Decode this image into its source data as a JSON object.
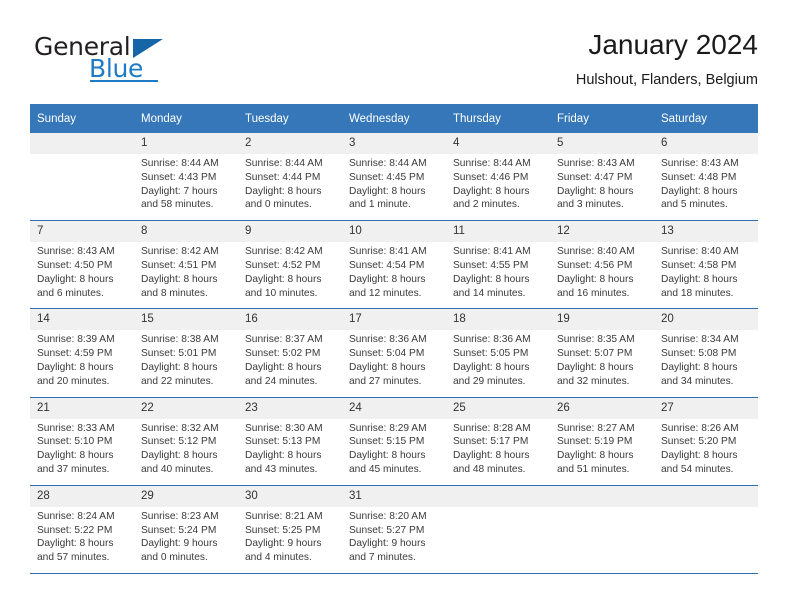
{
  "brand": {
    "name_top": "General",
    "name_bottom": "Blue",
    "accent_color": "#1f7cc4",
    "triangle_color": "#1565a8"
  },
  "header": {
    "title": "January 2024",
    "subtitle": "Hulshout, Flanders, Belgium"
  },
  "theme": {
    "header_row_bg": "#3577b9",
    "header_row_text": "#ffffff",
    "daynum_bg": "#f0f0f0",
    "rule_color": "#2f6fae"
  },
  "columns": [
    "Sunday",
    "Monday",
    "Tuesday",
    "Wednesday",
    "Thursday",
    "Friday",
    "Saturday"
  ],
  "weeks": [
    [
      {
        "day": "",
        "empty": true,
        "sunrise": "",
        "sunset": "",
        "daylight1": "",
        "daylight2": ""
      },
      {
        "day": "1",
        "sunrise": "Sunrise: 8:44 AM",
        "sunset": "Sunset: 4:43 PM",
        "daylight1": "Daylight: 7 hours",
        "daylight2": "and 58 minutes."
      },
      {
        "day": "2",
        "sunrise": "Sunrise: 8:44 AM",
        "sunset": "Sunset: 4:44 PM",
        "daylight1": "Daylight: 8 hours",
        "daylight2": "and 0 minutes."
      },
      {
        "day": "3",
        "sunrise": "Sunrise: 8:44 AM",
        "sunset": "Sunset: 4:45 PM",
        "daylight1": "Daylight: 8 hours",
        "daylight2": "and 1 minute."
      },
      {
        "day": "4",
        "sunrise": "Sunrise: 8:44 AM",
        "sunset": "Sunset: 4:46 PM",
        "daylight1": "Daylight: 8 hours",
        "daylight2": "and 2 minutes."
      },
      {
        "day": "5",
        "sunrise": "Sunrise: 8:43 AM",
        "sunset": "Sunset: 4:47 PM",
        "daylight1": "Daylight: 8 hours",
        "daylight2": "and 3 minutes."
      },
      {
        "day": "6",
        "sunrise": "Sunrise: 8:43 AM",
        "sunset": "Sunset: 4:48 PM",
        "daylight1": "Daylight: 8 hours",
        "daylight2": "and 5 minutes."
      }
    ],
    [
      {
        "day": "7",
        "sunrise": "Sunrise: 8:43 AM",
        "sunset": "Sunset: 4:50 PM",
        "daylight1": "Daylight: 8 hours",
        "daylight2": "and 6 minutes."
      },
      {
        "day": "8",
        "sunrise": "Sunrise: 8:42 AM",
        "sunset": "Sunset: 4:51 PM",
        "daylight1": "Daylight: 8 hours",
        "daylight2": "and 8 minutes."
      },
      {
        "day": "9",
        "sunrise": "Sunrise: 8:42 AM",
        "sunset": "Sunset: 4:52 PM",
        "daylight1": "Daylight: 8 hours",
        "daylight2": "and 10 minutes."
      },
      {
        "day": "10",
        "sunrise": "Sunrise: 8:41 AM",
        "sunset": "Sunset: 4:54 PM",
        "daylight1": "Daylight: 8 hours",
        "daylight2": "and 12 minutes."
      },
      {
        "day": "11",
        "sunrise": "Sunrise: 8:41 AM",
        "sunset": "Sunset: 4:55 PM",
        "daylight1": "Daylight: 8 hours",
        "daylight2": "and 14 minutes."
      },
      {
        "day": "12",
        "sunrise": "Sunrise: 8:40 AM",
        "sunset": "Sunset: 4:56 PM",
        "daylight1": "Daylight: 8 hours",
        "daylight2": "and 16 minutes."
      },
      {
        "day": "13",
        "sunrise": "Sunrise: 8:40 AM",
        "sunset": "Sunset: 4:58 PM",
        "daylight1": "Daylight: 8 hours",
        "daylight2": "and 18 minutes."
      }
    ],
    [
      {
        "day": "14",
        "sunrise": "Sunrise: 8:39 AM",
        "sunset": "Sunset: 4:59 PM",
        "daylight1": "Daylight: 8 hours",
        "daylight2": "and 20 minutes."
      },
      {
        "day": "15",
        "sunrise": "Sunrise: 8:38 AM",
        "sunset": "Sunset: 5:01 PM",
        "daylight1": "Daylight: 8 hours",
        "daylight2": "and 22 minutes."
      },
      {
        "day": "16",
        "sunrise": "Sunrise: 8:37 AM",
        "sunset": "Sunset: 5:02 PM",
        "daylight1": "Daylight: 8 hours",
        "daylight2": "and 24 minutes."
      },
      {
        "day": "17",
        "sunrise": "Sunrise: 8:36 AM",
        "sunset": "Sunset: 5:04 PM",
        "daylight1": "Daylight: 8 hours",
        "daylight2": "and 27 minutes."
      },
      {
        "day": "18",
        "sunrise": "Sunrise: 8:36 AM",
        "sunset": "Sunset: 5:05 PM",
        "daylight1": "Daylight: 8 hours",
        "daylight2": "and 29 minutes."
      },
      {
        "day": "19",
        "sunrise": "Sunrise: 8:35 AM",
        "sunset": "Sunset: 5:07 PM",
        "daylight1": "Daylight: 8 hours",
        "daylight2": "and 32 minutes."
      },
      {
        "day": "20",
        "sunrise": "Sunrise: 8:34 AM",
        "sunset": "Sunset: 5:08 PM",
        "daylight1": "Daylight: 8 hours",
        "daylight2": "and 34 minutes."
      }
    ],
    [
      {
        "day": "21",
        "sunrise": "Sunrise: 8:33 AM",
        "sunset": "Sunset: 5:10 PM",
        "daylight1": "Daylight: 8 hours",
        "daylight2": "and 37 minutes."
      },
      {
        "day": "22",
        "sunrise": "Sunrise: 8:32 AM",
        "sunset": "Sunset: 5:12 PM",
        "daylight1": "Daylight: 8 hours",
        "daylight2": "and 40 minutes."
      },
      {
        "day": "23",
        "sunrise": "Sunrise: 8:30 AM",
        "sunset": "Sunset: 5:13 PM",
        "daylight1": "Daylight: 8 hours",
        "daylight2": "and 43 minutes."
      },
      {
        "day": "24",
        "sunrise": "Sunrise: 8:29 AM",
        "sunset": "Sunset: 5:15 PM",
        "daylight1": "Daylight: 8 hours",
        "daylight2": "and 45 minutes."
      },
      {
        "day": "25",
        "sunrise": "Sunrise: 8:28 AM",
        "sunset": "Sunset: 5:17 PM",
        "daylight1": "Daylight: 8 hours",
        "daylight2": "and 48 minutes."
      },
      {
        "day": "26",
        "sunrise": "Sunrise: 8:27 AM",
        "sunset": "Sunset: 5:19 PM",
        "daylight1": "Daylight: 8 hours",
        "daylight2": "and 51 minutes."
      },
      {
        "day": "27",
        "sunrise": "Sunrise: 8:26 AM",
        "sunset": "Sunset: 5:20 PM",
        "daylight1": "Daylight: 8 hours",
        "daylight2": "and 54 minutes."
      }
    ],
    [
      {
        "day": "28",
        "sunrise": "Sunrise: 8:24 AM",
        "sunset": "Sunset: 5:22 PM",
        "daylight1": "Daylight: 8 hours",
        "daylight2": "and 57 minutes."
      },
      {
        "day": "29",
        "sunrise": "Sunrise: 8:23 AM",
        "sunset": "Sunset: 5:24 PM",
        "daylight1": "Daylight: 9 hours",
        "daylight2": "and 0 minutes."
      },
      {
        "day": "30",
        "sunrise": "Sunrise: 8:21 AM",
        "sunset": "Sunset: 5:25 PM",
        "daylight1": "Daylight: 9 hours",
        "daylight2": "and 4 minutes."
      },
      {
        "day": "31",
        "sunrise": "Sunrise: 8:20 AM",
        "sunset": "Sunset: 5:27 PM",
        "daylight1": "Daylight: 9 hours",
        "daylight2": "and 7 minutes."
      },
      {
        "day": "",
        "empty": true,
        "sunrise": "",
        "sunset": "",
        "daylight1": "",
        "daylight2": ""
      },
      {
        "day": "",
        "empty": true,
        "sunrise": "",
        "sunset": "",
        "daylight1": "",
        "daylight2": ""
      },
      {
        "day": "",
        "empty": true,
        "sunrise": "",
        "sunset": "",
        "daylight1": "",
        "daylight2": ""
      }
    ]
  ]
}
